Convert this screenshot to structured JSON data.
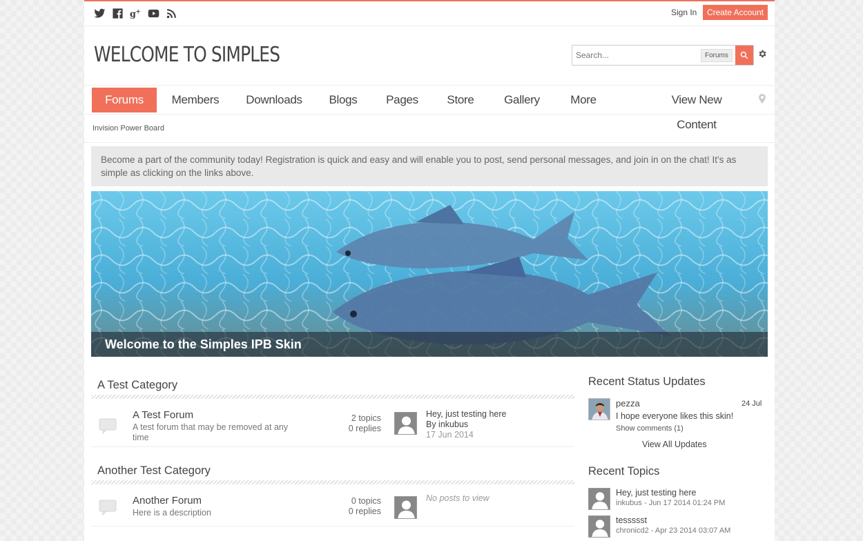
{
  "topbar": {
    "social": [
      "twitter-icon",
      "facebook-icon",
      "google-plus-icon",
      "youtube-icon",
      "rss-icon"
    ],
    "signin_label": "Sign In",
    "create_label": "Create Account"
  },
  "header": {
    "title": "WELCOME TO SIMPLES",
    "search_placeholder": "Search...",
    "search_scope": "Forums"
  },
  "nav": {
    "items": [
      "Forums",
      "Members",
      "Downloads",
      "Blogs",
      "Pages",
      "Store",
      "Gallery",
      "More"
    ],
    "view_new": "View New Content"
  },
  "breadcrumb": "Invision Power Board",
  "notice": "Become a part of the community today! Registration is quick and easy and will enable you to post, send personal messages, and join in on the chat! It's as simple as clicking on the links above.",
  "banner": {
    "caption": "Welcome to the Simples IPB Skin"
  },
  "categories": [
    {
      "title": "A Test Category",
      "forum": {
        "name": "A Test Forum",
        "description": "A test forum that may be removed at any time",
        "topics": "2 topics",
        "replies": "0 replies",
        "last_title": "Hey, just testing here",
        "last_by": "By inkubus",
        "last_date": "17 Jun 2014"
      }
    },
    {
      "title": "Another Test Category",
      "forum": {
        "name": "Another Forum",
        "description": "Here is a description",
        "topics": "0 topics",
        "replies": "0 replies",
        "last_title": "No posts to view"
      }
    }
  ],
  "sidebar": {
    "status_title": "Recent Status Updates",
    "status": {
      "user": "pezza",
      "date": "24 Jul",
      "text": "I hope everyone likes this skin!",
      "comments": "Show comments (1)"
    },
    "view_all": "View All Updates",
    "topics_title": "Recent Topics",
    "topics": [
      {
        "title": "Hey, just testing here",
        "meta": "inkubus - Jun 17 2014 01:24 PM"
      },
      {
        "title": "tessssst",
        "meta": "chronicd2 - Apr 23 2014 03:07 AM"
      }
    ]
  },
  "colors": {
    "accent": "#f0705a",
    "text": "#444444",
    "notice_bg": "#e9e9e9"
  }
}
